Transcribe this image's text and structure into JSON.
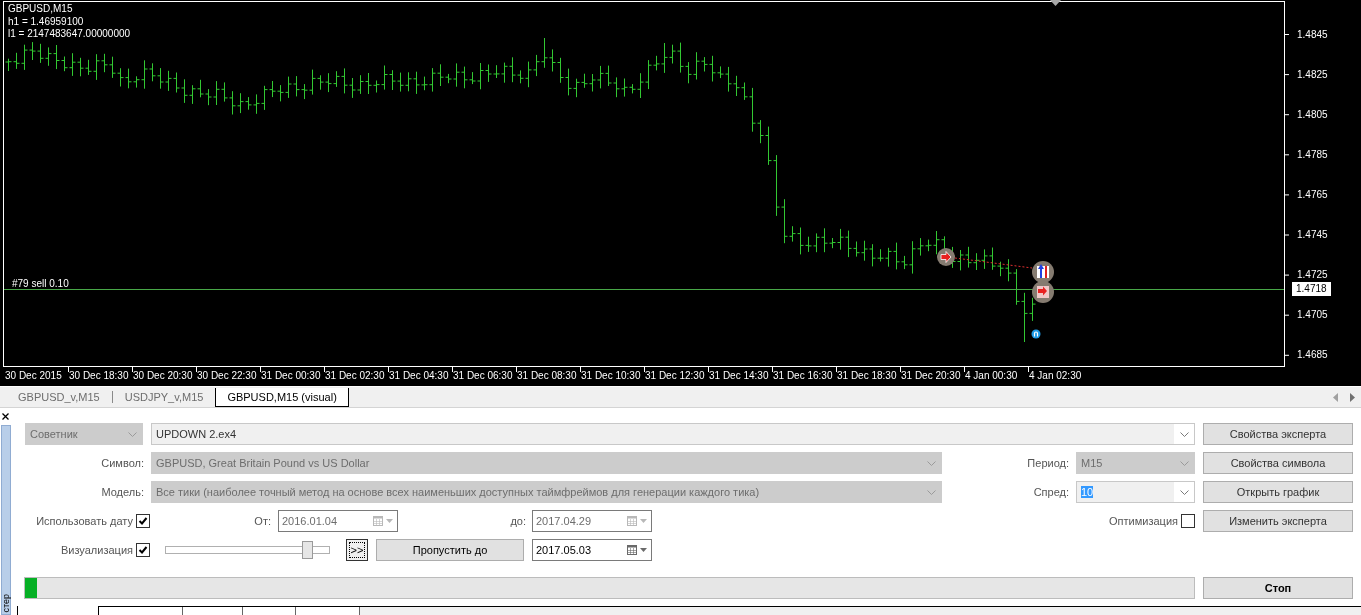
{
  "chart": {
    "title": "GBPUSD,M15",
    "info_lines": [
      "h1 = 1.46959100",
      "l1 = 2147483647.00000000"
    ],
    "order_line": {
      "label": "#79 sell 0.10",
      "price": "1.4718"
    },
    "price_axis": [
      "1.4845",
      "1.4825",
      "1.4805",
      "1.4785",
      "1.4765",
      "1.4745",
      "1.4725",
      "1.4705",
      "1.4685"
    ],
    "time_axis": [
      "30 Dec 2015",
      "30 Dec 18:30",
      "30 Dec 20:30",
      "30 Dec 22:30",
      "31 Dec 00:30",
      "31 Dec 02:30",
      "31 Dec 04:30",
      "31 Dec 06:30",
      "31 Dec 08:30",
      "31 Dec 10:30",
      "31 Dec 12:30",
      "31 Dec 14:30",
      "31 Dec 16:30",
      "31 Dec 18:30",
      "31 Dec 20:30",
      "4 Jan 00:30",
      "4 Jan 02:30"
    ]
  },
  "chart_tabs": [
    {
      "label": "GBPUSD_v,M15",
      "selected": false
    },
    {
      "label": "USDJPY_v,M15",
      "selected": false
    },
    {
      "label": "GBPUSD,M15 (visual)",
      "selected": true
    }
  ],
  "tester": {
    "title": "стер",
    "program_type": {
      "value": "Советник",
      "disabled": true
    },
    "expert": {
      "value": "UPDOWN 2.ex4",
      "disabled": false
    },
    "symbol": {
      "label": "Символ:",
      "value": "GBPUSD, Great Britain Pound vs US Dollar",
      "disabled": true
    },
    "period": {
      "label": "Период:",
      "value": "M15",
      "disabled": true
    },
    "model": {
      "label": "Модель:",
      "value": "Все тики (наиболее точный метод на основе всех наименьших доступных таймфреймов для генерации каждого тика)",
      "disabled": true
    },
    "spread": {
      "label": "Спред:",
      "value": "10",
      "disabled": false,
      "highlighted": true
    },
    "use_date": {
      "label": "Использовать дату",
      "checked": true
    },
    "date_from": {
      "label": "От:",
      "value": "2016.01.04",
      "disabled": true
    },
    "date_to": {
      "label": "до:",
      "value": "2017.04.29",
      "disabled": true
    },
    "optimization": {
      "label": "Оптимизация",
      "checked": false
    },
    "visualization": {
      "label": "Визуализация",
      "checked": true
    },
    "speed": {
      "level": 0.89
    },
    "step_button": {
      "label": ">>"
    },
    "skip_button": {
      "label": "Пропустить до"
    },
    "skip_date": {
      "value": "2017.05.03",
      "disabled": false
    },
    "progress": {
      "level": 0.01
    },
    "buttons": [
      {
        "label": "Свойства эксперта"
      },
      {
        "label": "Свойства символа"
      },
      {
        "label": "Открыть график"
      },
      {
        "label": "Изменить эксперта"
      }
    ],
    "stop_button": {
      "label": "Стоп"
    }
  }
}
